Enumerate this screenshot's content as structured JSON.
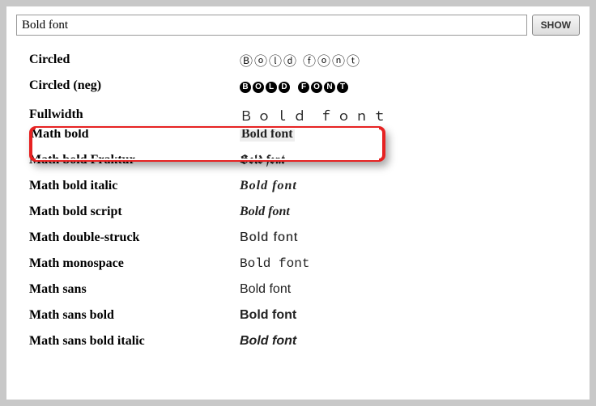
{
  "search": {
    "value": "Bold font",
    "button": "SHOW"
  },
  "highlight": {
    "target_label": "Math bold",
    "color": "#e62222"
  },
  "rows": [
    {
      "label": "Circled",
      "value": "Ⓑⓞⓛⓓ ⓕⓞⓝⓣ"
    },
    {
      "label": "Circled (neg)",
      "value": "BOLD FONT"
    },
    {
      "label": "Fullwidth",
      "value": "Ｂｏｌｄ ｆｏｎｔ"
    },
    {
      "label": "Math bold",
      "value": "Bold font"
    },
    {
      "label": "Math bold Fraktur",
      "value": "Bold font"
    },
    {
      "label": "Math bold italic",
      "value": "Bold font"
    },
    {
      "label": "Math bold script",
      "value": "Bold font"
    },
    {
      "label": "Math double-struck",
      "value": "Bold font"
    },
    {
      "label": "Math monospace",
      "value": "Bold font"
    },
    {
      "label": "Math sans",
      "value": "Bold font"
    },
    {
      "label": "Math sans bold",
      "value": "Bold font"
    },
    {
      "label": "Math sans bold italic",
      "value": "Bold font"
    }
  ]
}
